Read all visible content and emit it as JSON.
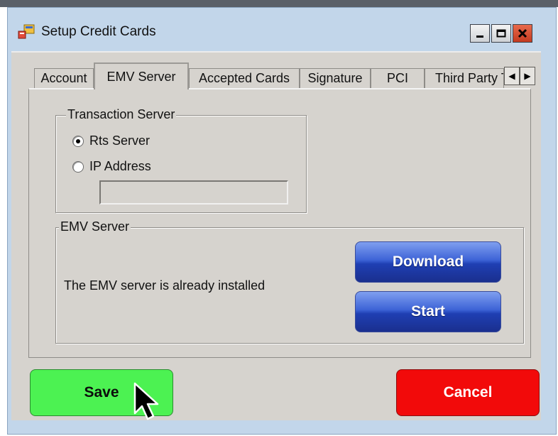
{
  "window": {
    "title": "Setup Credit Cards",
    "controls": [
      "minimize-icon",
      "maximize-icon",
      "close-icon"
    ]
  },
  "tabs": [
    {
      "label": "Account"
    },
    {
      "label": "EMV Server",
      "active": true
    },
    {
      "label": "Accepted Cards"
    },
    {
      "label": "Signature"
    },
    {
      "label": "PCI"
    },
    {
      "label": "Third Party T"
    }
  ],
  "tab_scroll": {
    "left": "◀",
    "right": "▶"
  },
  "transaction_server": {
    "label": "Transaction Server",
    "options": [
      {
        "label": "Rts Server",
        "checked": true
      },
      {
        "label": "IP Address",
        "checked": false
      }
    ],
    "ip_value": ""
  },
  "emv_server": {
    "label": "EMV Server",
    "status": "The EMV server is already installed",
    "download_label": "Download",
    "start_label": "Start"
  },
  "footer": {
    "save_label": "Save",
    "cancel_label": "Cancel"
  },
  "colors": {
    "save": "#4cf252",
    "cancel": "#f20a0a",
    "action_button": "#2a4fc8",
    "window_frame": "#c2d6ea",
    "client": "#d6d3ce"
  }
}
